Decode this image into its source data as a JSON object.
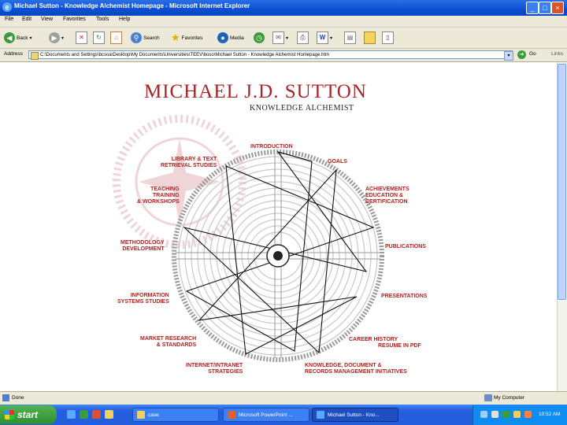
{
  "window": {
    "title": "Michael Sutton - Knowledge Alchemist Homepage - Microsoft Internet Explorer",
    "min": "_",
    "max": "□",
    "close": "×"
  },
  "menu": [
    "File",
    "Edit",
    "View",
    "Favorites",
    "Tools",
    "Help"
  ],
  "toolbar": {
    "back": "Back",
    "search": "Search",
    "favorites": "Favorites",
    "media": "Media"
  },
  "address": {
    "label": "Address",
    "value": "C:\\Documents and Settings\\bcsoa\\Desktop\\My Documents\\Universities\\TEEV\\boso\\Michael Sutton - Knowledge Alchemist Homepage.htm",
    "go": "Go",
    "links": "Links"
  },
  "page": {
    "title": "MICHAEL J.D. SUTTON",
    "subtitle": "KNOWLEDGE ALCHEMIST",
    "nav": [
      {
        "id": "introduction",
        "lines": [
          "INTRODUCTION"
        ]
      },
      {
        "id": "goals",
        "lines": [
          "GOALS"
        ]
      },
      {
        "id": "achievements",
        "lines": [
          "ACHIEVEMENTS",
          "EDUCATION &",
          "CERTIFICATION"
        ]
      },
      {
        "id": "publications",
        "lines": [
          "PUBLICATIONS"
        ]
      },
      {
        "id": "presentations",
        "lines": [
          "PRESENTATIONS"
        ]
      },
      {
        "id": "career",
        "lines": [
          "CAREER HISTORY",
          "RESUME IN PDF"
        ]
      },
      {
        "id": "knowledge",
        "lines": [
          "KNOWLEDGE, DOCUMENT &",
          "RECORDS MANAGEMENT INITIATIVES"
        ]
      },
      {
        "id": "internet",
        "lines": [
          "INTERNET/INTRANET",
          "STRATEGIES"
        ]
      },
      {
        "id": "market",
        "lines": [
          "MARKET RESEARCH",
          "& STANDARDS"
        ]
      },
      {
        "id": "information",
        "lines": [
          "INFORMATION",
          "SYSTEMS STUDIES"
        ]
      },
      {
        "id": "methodology",
        "lines": [
          "METHODOLOGY",
          "DEVELOPMENT"
        ]
      },
      {
        "id": "teaching",
        "lines": [
          "TEACHING",
          "TRAINING",
          "& WORKSHOPS"
        ]
      },
      {
        "id": "library",
        "lines": [
          "LIBRARY & TEXT",
          "RETRIEVAL STUDIES"
        ]
      }
    ]
  },
  "status": {
    "text": "Done",
    "zone": "My Computer"
  },
  "taskbar": {
    "start": "start",
    "tasks": [
      "case",
      "Microsoft PowerPoint ...",
      "Michael Sutton - Kno..."
    ],
    "clock": "10:52 AM"
  }
}
